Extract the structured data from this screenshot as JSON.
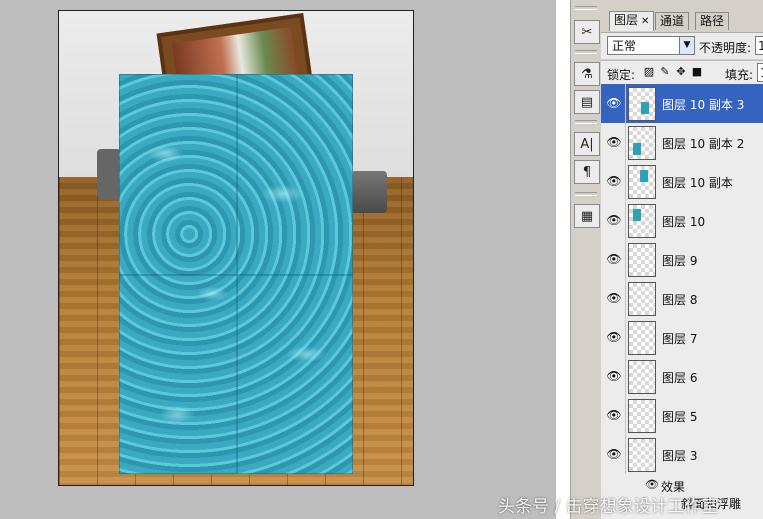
{
  "panel": {
    "tabs": [
      {
        "label": "图层",
        "active": true
      },
      {
        "label": "通道",
        "active": false
      },
      {
        "label": "路径",
        "active": false
      }
    ],
    "blend_mode": "正常",
    "opacity_label": "不透明度:",
    "opacity_value": "1",
    "lock_label": "锁定:",
    "fill_label": "填充:",
    "fill_value": "1",
    "layers": [
      {
        "name": "图层 10 副本 3",
        "selected": true
      },
      {
        "name": "图层 10 副本 2",
        "selected": false
      },
      {
        "name": "图层 10 副本",
        "selected": false
      },
      {
        "name": "图层 10",
        "selected": false
      },
      {
        "name": "图层 9",
        "selected": false
      },
      {
        "name": "图层 8",
        "selected": false
      },
      {
        "name": "图层 7",
        "selected": false
      },
      {
        "name": "图层 6",
        "selected": false
      },
      {
        "name": "图层 5",
        "selected": false
      },
      {
        "name": "图层 3",
        "selected": false
      }
    ],
    "effects_label": "效果",
    "effects_sub_label": "斜面和浮雕"
  },
  "toolstrip": {
    "icons": [
      "brush-tools-icon",
      "eyedropper-icon",
      "stamp-icon",
      "character-icon",
      "paragraph-icon",
      "layer-comps-icon"
    ],
    "character_glyph": "A|",
    "paragraph_glyph": "¶"
  },
  "colors": {
    "selection": "#3563c0",
    "panel_bg": "#d4d0c8",
    "water": "#39a5bd"
  },
  "watermark": "头条号 / 击穿想象设计工作室"
}
